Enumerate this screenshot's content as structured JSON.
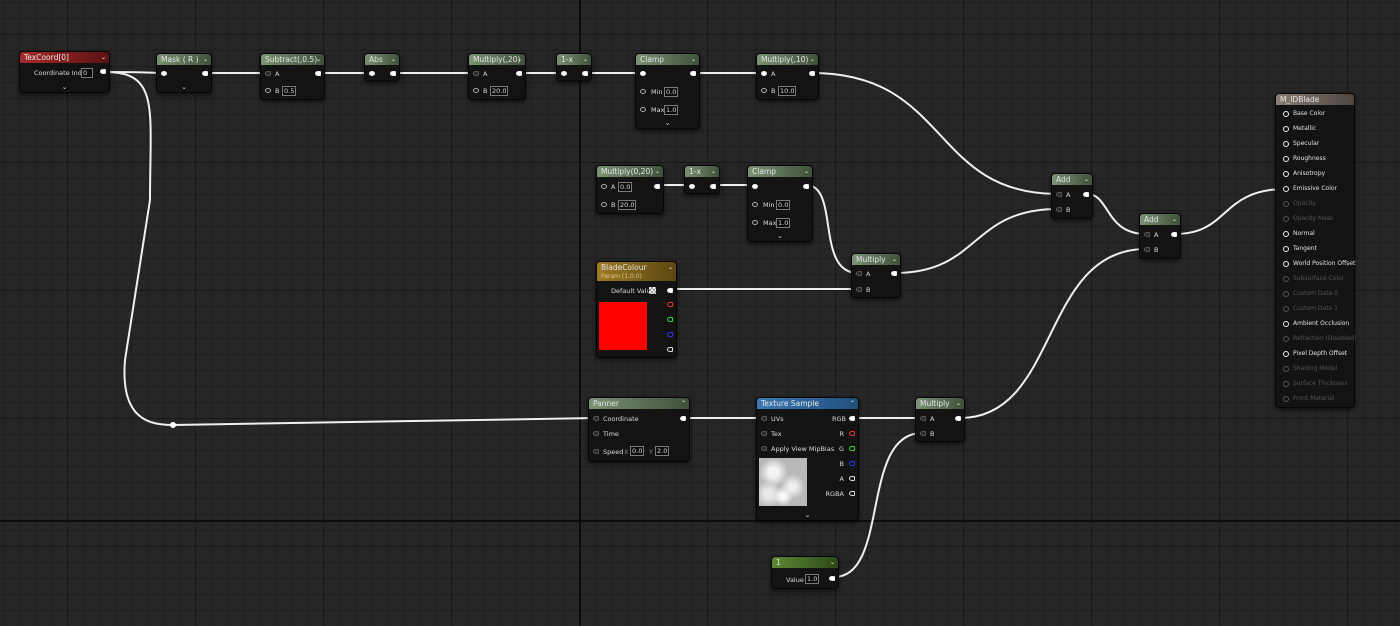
{
  "nodes": {
    "texcoord": {
      "title": "TexCoord[0]",
      "coord_label": "Coordinate Index",
      "coord_value": "0"
    },
    "mask": {
      "title": "Mask ( R )"
    },
    "subtract": {
      "title": "Subtract(,0.5)",
      "a": "A",
      "b": "B",
      "b_value": "0.5"
    },
    "abs": {
      "title": "Abs"
    },
    "multiply20": {
      "title": "Multiply(,20)",
      "a": "A",
      "b": "B",
      "b_value": "20.0"
    },
    "oneminus1": {
      "title": "1-x"
    },
    "clamp1": {
      "title": "Clamp",
      "min": "Min",
      "min_value": "0.0",
      "max": "Max",
      "max_value": "1.0"
    },
    "multiply10": {
      "title": "Multiply(,10)",
      "a": "A",
      "b": "B",
      "b_value": "10.0"
    },
    "multiply0_20": {
      "title": "Multiply(0,20)",
      "a": "A",
      "a_value": "0.0",
      "b": "B",
      "b_value": "20.0"
    },
    "oneminus2": {
      "title": "1-x"
    },
    "clamp2": {
      "title": "Clamp",
      "min": "Min",
      "min_value": "0.0",
      "max": "Max",
      "max_value": "1.0"
    },
    "add1": {
      "title": "Add",
      "a": "A",
      "b": "B"
    },
    "add2": {
      "title": "Add",
      "a": "A",
      "b": "B"
    },
    "multiply_mid": {
      "title": "Multiply",
      "a": "A",
      "b": "B"
    },
    "bladecolour": {
      "title": "BladeColour",
      "subtitle": "Param (1,0,0)",
      "default_label": "Default Value"
    },
    "panner": {
      "title": "Panner",
      "coordinate": "Coordinate",
      "time": "Time",
      "speed": "Speed",
      "x_label": "X",
      "x_value": "0.0",
      "y_label": "Y",
      "y_value": "2.0"
    },
    "texture": {
      "title": "Texture Sample",
      "uvs": "UVs",
      "tex": "Tex",
      "mip": "Apply View MipBias",
      "rgb": "RGB",
      "r": "R",
      "g": "G",
      "b": "B",
      "a": "A",
      "rgba": "RGBA"
    },
    "multiply_low": {
      "title": "Multiply",
      "a": "A",
      "b": "B"
    },
    "const1": {
      "title": "1",
      "value_label": "Value",
      "value": "1.0"
    },
    "material": {
      "title": "M_IDBlade",
      "inputs": [
        {
          "label": "Base Color",
          "enabled": true
        },
        {
          "label": "Metallic",
          "enabled": true
        },
        {
          "label": "Specular",
          "enabled": true
        },
        {
          "label": "Roughness",
          "enabled": true
        },
        {
          "label": "Anisotropy",
          "enabled": true
        },
        {
          "label": "Emissive Color",
          "enabled": true
        },
        {
          "label": "Opacity",
          "enabled": false
        },
        {
          "label": "Opacity Mask",
          "enabled": false
        },
        {
          "label": "Normal",
          "enabled": true
        },
        {
          "label": "Tangent",
          "enabled": true
        },
        {
          "label": "World Position Offset",
          "enabled": true
        },
        {
          "label": "Subsurface Color",
          "enabled": false
        },
        {
          "label": "Custom Data 0",
          "enabled": false
        },
        {
          "label": "Custom Data 1",
          "enabled": false
        },
        {
          "label": "Ambient Occlusion",
          "enabled": true
        },
        {
          "label": "Refraction (Disabled)",
          "enabled": false
        },
        {
          "label": "Pixel Depth Offset",
          "enabled": true
        },
        {
          "label": "Shading Model",
          "enabled": false
        },
        {
          "label": "Surface Thickness",
          "enabled": false
        },
        {
          "label": "Front Material",
          "enabled": false
        }
      ]
    }
  },
  "colors": {
    "wire": "#f2f2f2",
    "blade_color_swatch": "#ff0000",
    "grid_bg": "#262626"
  }
}
